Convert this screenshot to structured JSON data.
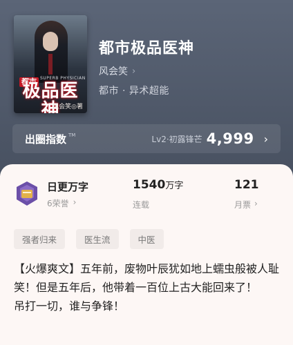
{
  "book": {
    "title": "都市极品医神",
    "author": "风会笑",
    "genre": "都市 · 异术超能",
    "cover": {
      "title_art": "极品医神",
      "badge": "都市",
      "sub_en": "SUPERB PHYSICIAN",
      "author_art": "风会笑◎著"
    }
  },
  "index": {
    "label": "出圈指数",
    "level": "Lv2·初露锋芒",
    "score": "4,999"
  },
  "stats": {
    "update": {
      "name": "日更万字",
      "sub": "6荣誉"
    },
    "words": {
      "value": "1540",
      "unit": "万字",
      "label": "连载"
    },
    "tickets": {
      "value": "121",
      "label": "月票"
    }
  },
  "tags": [
    "强者归来",
    "医生流",
    "中医"
  ],
  "description": [
    "【火爆爽文】五年前，废物叶辰犹如地上蠕虫般被人耻笑！但是五年后，他带着一百位上古大能回来了！",
    "吊打一切，谁与争锋！"
  ],
  "colors": {
    "accent_red": "#c41a26",
    "medal_purple": "#6b4fa8",
    "medal_gold": "#e3b24a"
  }
}
